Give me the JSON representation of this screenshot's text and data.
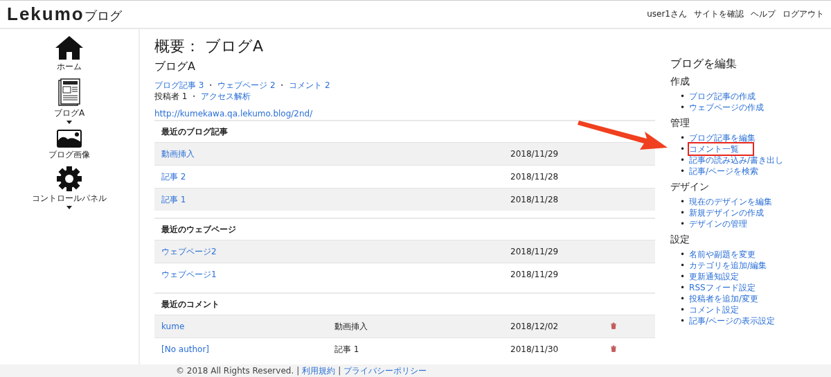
{
  "header": {
    "logo": "Lekumo",
    "logo_suffix": "ブログ",
    "nav": [
      "user1さん",
      "サイトを確認",
      "ヘルプ",
      "ログアウト"
    ]
  },
  "sidebar": {
    "items": [
      {
        "kind": "home",
        "label": "ホーム",
        "expandable": false
      },
      {
        "kind": "blog",
        "label": "ブログA",
        "expandable": true
      },
      {
        "kind": "image",
        "label": "ブログ画像",
        "expandable": false
      },
      {
        "kind": "gear",
        "label": "コントロールパネル",
        "expandable": true
      }
    ]
  },
  "main": {
    "title": "概要： ブログA",
    "blog_name": "ブログA",
    "stats_line_1": [
      {
        "text": "ブログ記事 3",
        "link": true
      },
      {
        "text": "ウェブページ 2",
        "link": true
      },
      {
        "text": "コメント 2",
        "link": true
      }
    ],
    "stats_line_2": [
      {
        "text": "投稿者 1",
        "link": false
      },
      {
        "text": "アクセス解析",
        "link": true
      }
    ],
    "separator": "・",
    "url": "http://kumekawa.qa.lekumo.blog/2nd/",
    "sections": [
      {
        "heading": "最近のブログ記事",
        "rows": [
          {
            "title": "動画挿入",
            "date": "2018/11/29"
          },
          {
            "title": "記事 2",
            "date": "2018/11/28"
          },
          {
            "title": "記事 1",
            "date": "2018/11/28"
          }
        ]
      },
      {
        "heading": "最近のウェブページ",
        "rows": [
          {
            "title": "ウェブページ2",
            "date": "2018/11/29"
          },
          {
            "title": "ウェブページ1",
            "date": "2018/11/29"
          }
        ]
      },
      {
        "heading": "最近のコメント",
        "rows": [
          {
            "title": "kume",
            "entry": "動画挿入",
            "date": "2018/12/02",
            "deletable": true
          },
          {
            "title": "[No author]",
            "entry": "記事 1",
            "date": "2018/11/30",
            "deletable": true
          }
        ]
      }
    ]
  },
  "edit_panel": {
    "title": "ブログを編集",
    "bullet": "•",
    "groups": [
      {
        "heading": "作成",
        "items": [
          {
            "label": "ブログ記事の作成",
            "highlighted": false
          },
          {
            "label": "ウェブページの作成",
            "highlighted": false
          }
        ]
      },
      {
        "heading": "管理",
        "items": [
          {
            "label": "ブログ記事を編集",
            "highlighted": false
          },
          {
            "label": "コメント一覧",
            "highlighted": true
          },
          {
            "label": "記事の読み込み/書き出し",
            "highlighted": false
          },
          {
            "label": "記事/ページを検索",
            "highlighted": false
          }
        ]
      },
      {
        "heading": "デザイン",
        "items": [
          {
            "label": "現在のデザインを編集",
            "highlighted": false
          },
          {
            "label": "新規デザインの作成",
            "highlighted": false
          },
          {
            "label": "デザインの管理",
            "highlighted": false
          }
        ]
      },
      {
        "heading": "設定",
        "items": [
          {
            "label": "名前や副題を変更",
            "highlighted": false
          },
          {
            "label": "カテゴリを追加/編集",
            "highlighted": false
          },
          {
            "label": "更新通知設定",
            "highlighted": false
          },
          {
            "label": "RSSフィード設定",
            "highlighted": false
          },
          {
            "label": "投稿者を追加/変更",
            "highlighted": false
          },
          {
            "label": "コメント設定",
            "highlighted": false
          },
          {
            "label": "記事/ページの表示設定",
            "highlighted": false
          }
        ]
      }
    ]
  },
  "footer": {
    "copyright": "© 2018 All Rights Reserved.",
    "separator": "|",
    "links": [
      "利用規約",
      "プライバシーポリシー"
    ]
  }
}
